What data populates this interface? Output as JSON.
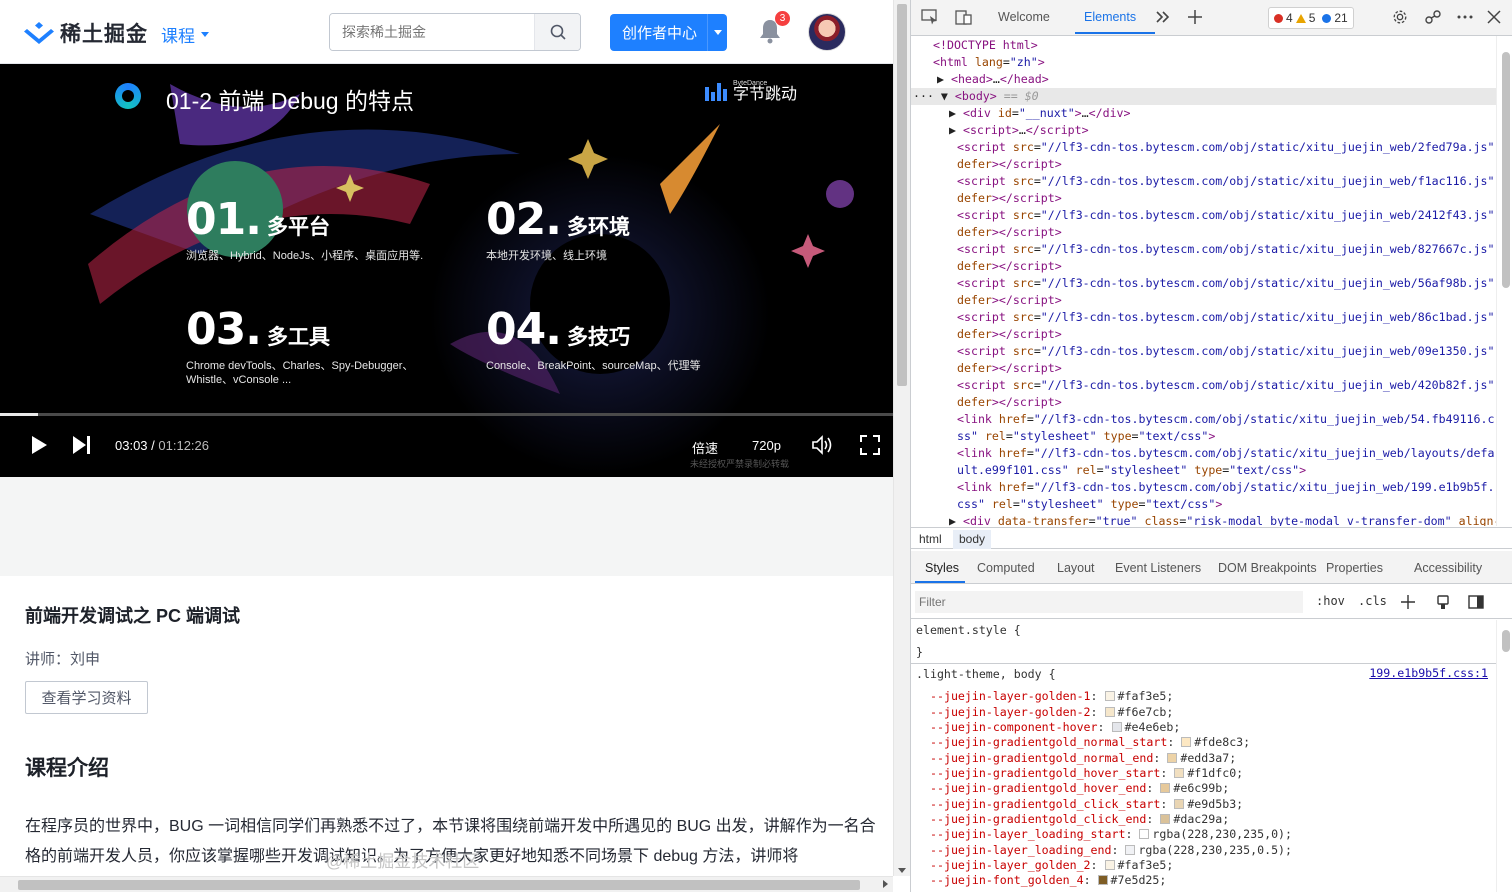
{
  "nav": {
    "logo_text": "稀土掘金",
    "course": "课程",
    "search_placeholder": "探索稀土掘金",
    "creator": "创作者中心",
    "notif_count": "3"
  },
  "video": {
    "slide_title": "01-2 前端 Debug 的特点",
    "brand_small": "ByteDance",
    "brand": "字节跳动",
    "points": [
      {
        "num": "01.",
        "label": "多平台",
        "desc": "浏览器、Hybrid、NodeJs、小程序、桌面应用等."
      },
      {
        "num": "02.",
        "label": "多环境",
        "desc": "本地开发环境、线上环境"
      },
      {
        "num": "03.",
        "label": "多工具",
        "desc": "Chrome devTools、Charles、Spy-Debugger、Whistle、vConsole ..."
      },
      {
        "num": "04.",
        "label": "多技巧",
        "desc": "Console、BreakPoint、sourceMap、代理等"
      }
    ],
    "current": "03:03",
    "sep": " / ",
    "total": "01:12:26",
    "speed": "倍速",
    "quality": "720p",
    "progress_fraction": 0.042,
    "watermark": "未经授权严禁录制必转载"
  },
  "course": {
    "title": "前端开发调试之 PC 端调试",
    "lecturer": "讲师：刘申",
    "materials_btn": "查看学习资料",
    "intro_heading": "课程介绍",
    "intro_text": "在程序员的世界中，BUG 一词相信同学们再熟悉不过了，本节课将围绕前端开发中所遇见的 BUG 出发，讲解作为一名合格的前端开发人员，你应该掌握哪些开发调试知识。为了方便大家更好地知悉不同场景下 debug 方法，讲师将"
  },
  "devtools": {
    "tabs": {
      "welcome": "Welcome",
      "elements": "Elements"
    },
    "errors": "4",
    "warnings": "5",
    "info": "21",
    "crumbs": [
      "html",
      "body"
    ],
    "sub_tabs": [
      "Styles",
      "Computed",
      "Layout",
      "Event Listeners",
      "DOM Breakpoints",
      "Properties",
      "Accessibility"
    ],
    "filter_placeholder": "Filter",
    "hov": ":hov",
    "cls": ".cls",
    "source_link": "199.e1b9b5f.css:1",
    "watermark": "@稀土掘金技术社区"
  },
  "colors": {
    "accent": "#1e80ff",
    "badge": "#f53f3f"
  }
}
